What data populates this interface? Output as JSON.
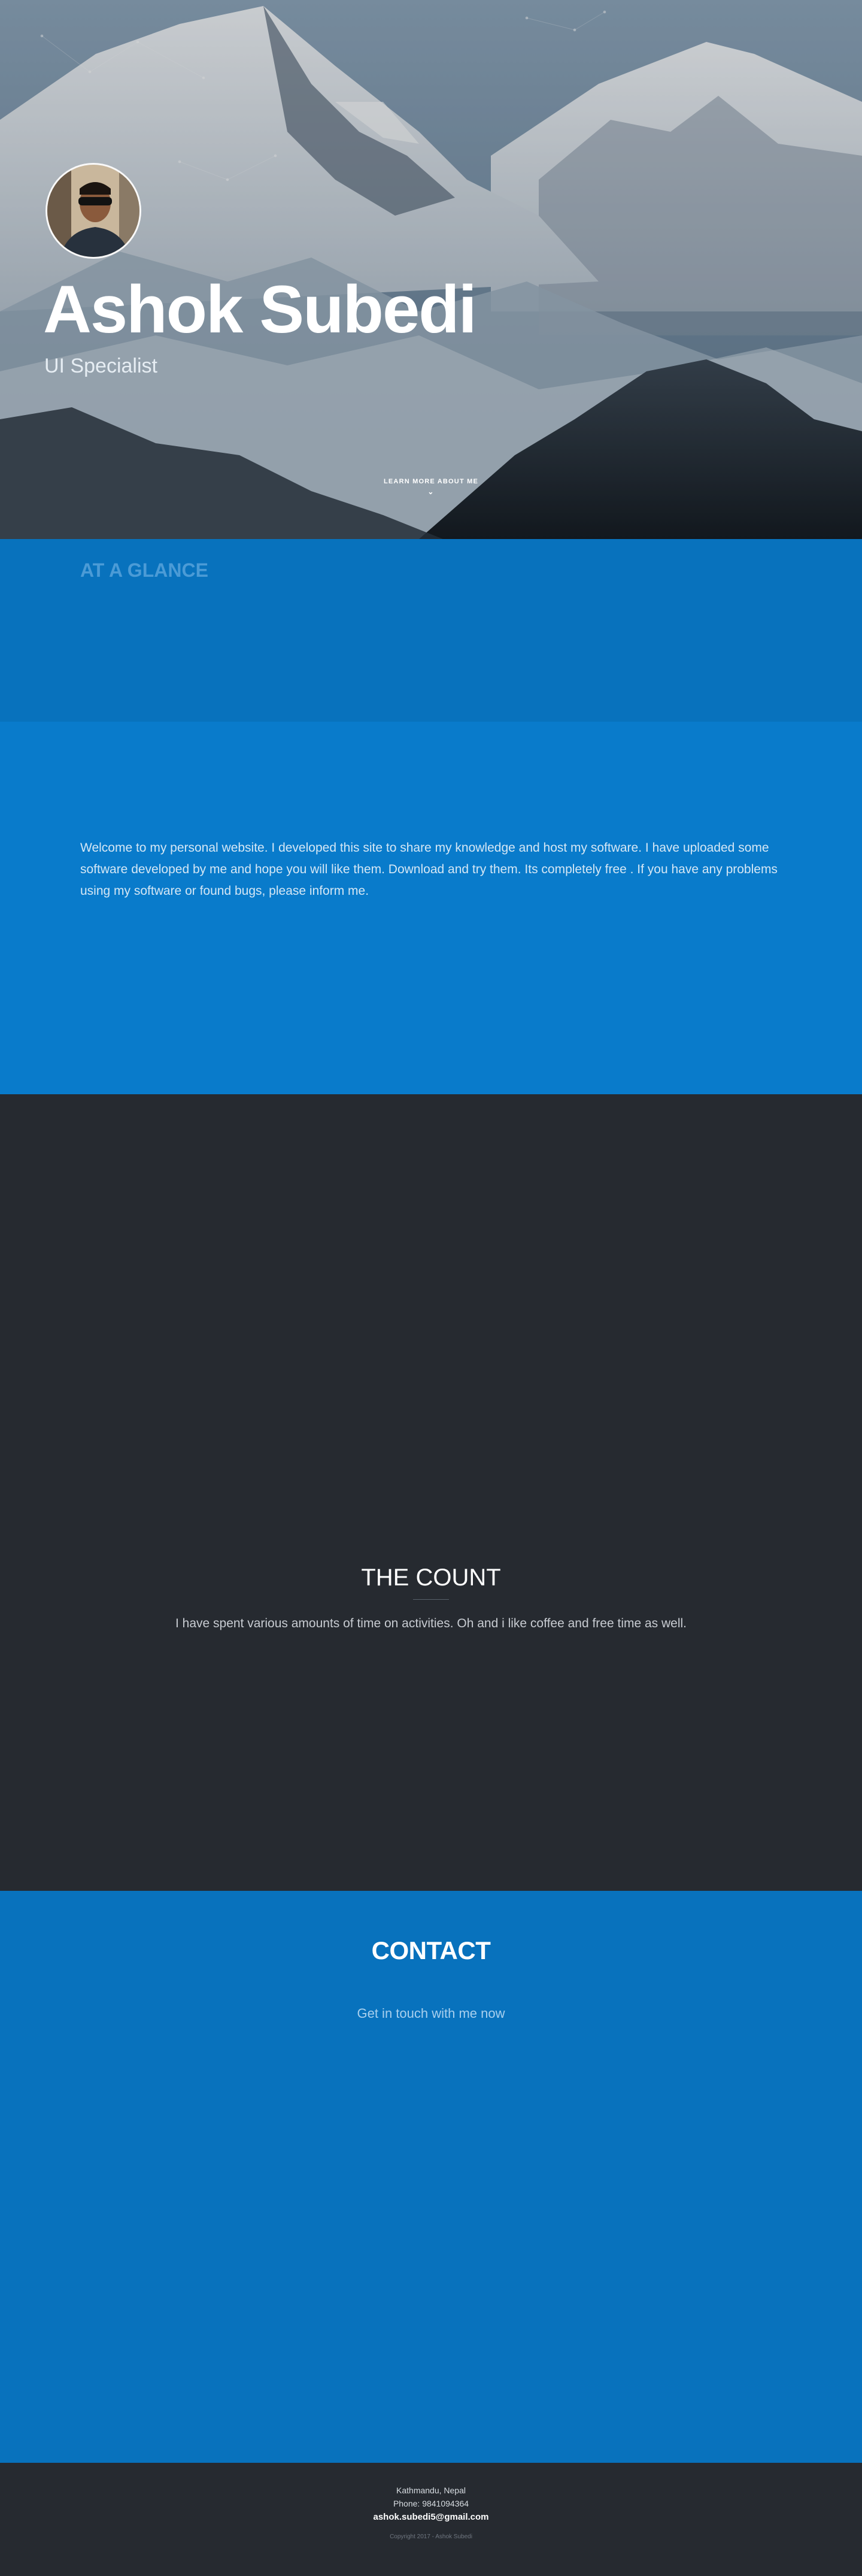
{
  "hero": {
    "name": "Ashok Subedi",
    "title": "UI Specialist",
    "learn_more": "LEARN MORE ABOUT ME",
    "chevron_icon": "chevron-down-icon",
    "avatar_icon": "profile-photo"
  },
  "glance": {
    "heading": "AT A GLANCE"
  },
  "about": {
    "text": "Welcome to my personal website. I developed this site to share my knowledge and host my software. I have uploaded some software developed by me and hope you will like them. Download and try them. Its completely free . If you have any problems using my software or found bugs, please inform me."
  },
  "count": {
    "heading": "THE COUNT",
    "text": "I have spent various amounts of time on activities. Oh and i like coffee and free time as well."
  },
  "contact": {
    "heading": "CONTACT",
    "text": "Get in touch with me now"
  },
  "footer": {
    "location": "Kathmandu, Nepal",
    "phone": "Phone: 9841094364",
    "email": "ashok.subedi5@gmail.com",
    "copyright": "Copyright 2017 - Ashok Subedi"
  },
  "colors": {
    "blue_dark": "#0872bd",
    "blue": "#097bcb",
    "charcoal": "#262a30"
  }
}
